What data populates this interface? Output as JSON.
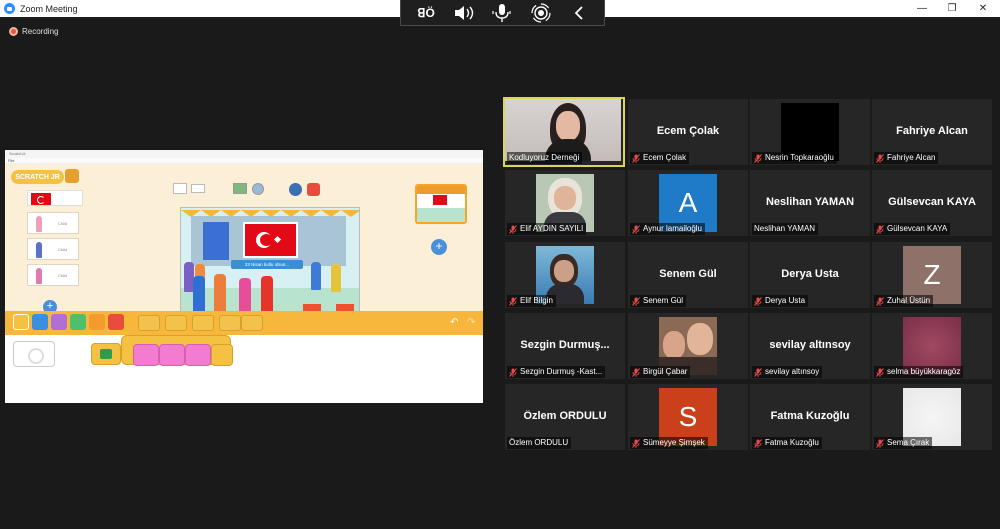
{
  "window": {
    "title": "Zoom Meeting",
    "controls": {
      "minimize": "—",
      "maximize": "❐",
      "close": "✕"
    }
  },
  "meeting_toolbar": {
    "icons": [
      "translate-icon",
      "speaker-icon",
      "microphone-icon",
      "broadcast-icon",
      "chevron-left-icon"
    ],
    "translate_label": "ꓭÖ"
  },
  "recording": {
    "label": "Recording",
    "color": "#e8563f"
  },
  "shared_screen": {
    "app_title": "ScratchJr",
    "menu": "File",
    "logo_text": "SCRATCH JR",
    "sprite_labels": [
      "Child",
      "Child",
      "Child"
    ],
    "stage_banner": "23 Nisan kutlu olsun...",
    "accent_orange": "#f6b73c",
    "flag_red": "#e30a17"
  },
  "participants": [
    {
      "display_name": "",
      "label": "Kodluyoruz Derneği",
      "muted": false,
      "kind": "photo",
      "active": true
    },
    {
      "display_name": "Ecem Çolak",
      "label": "Ecem Çolak",
      "muted": true,
      "kind": "name"
    },
    {
      "display_name": "",
      "label": "Nesrin Topkaraoğlu",
      "muted": true,
      "kind": "black"
    },
    {
      "display_name": "Fahriye Alcan",
      "label": "Fahriye Alcan",
      "muted": true,
      "kind": "name"
    },
    {
      "display_name": "",
      "label": "Elif AYDIN SAYILI",
      "muted": true,
      "kind": "photo"
    },
    {
      "display_name": "A",
      "label": "Aynur lamailoğlu",
      "muted": true,
      "kind": "letter",
      "color": "#1f7ac8"
    },
    {
      "display_name": "Neslihan YAMAN",
      "label": "Neslihan YAMAN",
      "muted": false,
      "kind": "name"
    },
    {
      "display_name": "Gülsevcan KAYA",
      "label": "Gülsevcan KAYA",
      "muted": true,
      "kind": "name"
    },
    {
      "display_name": "",
      "label": "Elif Bilgin",
      "muted": true,
      "kind": "photo"
    },
    {
      "display_name": "Senem Gül",
      "label": "Senem Gül",
      "muted": true,
      "kind": "name"
    },
    {
      "display_name": "Derya Usta",
      "label": "Derya Usta",
      "muted": true,
      "kind": "name"
    },
    {
      "display_name": "Z",
      "label": "Zuhal Üstün",
      "muted": true,
      "kind": "letter",
      "color": "#8e7269"
    },
    {
      "display_name": "Sezgin Durmuş...",
      "label": "Sezgin Durmuş -Kast...",
      "muted": true,
      "kind": "name"
    },
    {
      "display_name": "",
      "label": "Birgül Çabar",
      "muted": true,
      "kind": "photo"
    },
    {
      "display_name": "sevilay altınsoy",
      "label": "sevilay altınsoy",
      "muted": true,
      "kind": "name"
    },
    {
      "display_name": "",
      "label": "selma büyükkaragöz",
      "muted": true,
      "kind": "blur"
    },
    {
      "display_name": "Özlem ORDULU",
      "label": "Özlem ORDULU",
      "muted": false,
      "kind": "name"
    },
    {
      "display_name": "S",
      "label": "Sümeyye Şimşek",
      "muted": true,
      "kind": "letter",
      "color": "#c9401a"
    },
    {
      "display_name": "Fatma Kuzoğlu",
      "label": "Fatma Kuzoğlu",
      "muted": true,
      "kind": "name"
    },
    {
      "display_name": "",
      "label": "Sema Çırak",
      "muted": true,
      "kind": "white"
    }
  ]
}
